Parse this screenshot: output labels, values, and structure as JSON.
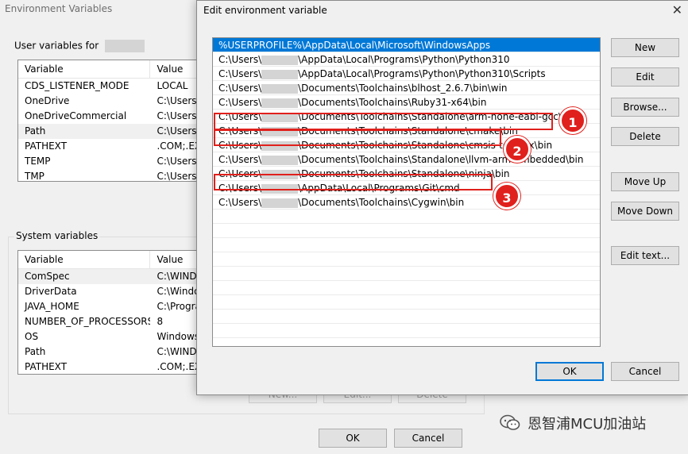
{
  "env_window": {
    "title": "Environment Variables",
    "user_group_label": "User variables for",
    "user_columns": [
      "Variable",
      "Value"
    ],
    "user_rows": [
      {
        "name": "CDS_LISTENER_MODE",
        "value": "LOCAL"
      },
      {
        "name": "OneDrive",
        "value": "C:\\Users\\"
      },
      {
        "name": "OneDriveCommercial",
        "value": "C:\\Users\\"
      },
      {
        "name": "Path",
        "value": "C:\\Users\\"
      },
      {
        "name": "PATHEXT",
        "value": ".COM;.EX"
      },
      {
        "name": "TEMP",
        "value": "C:\\Users\\"
      },
      {
        "name": "TMP",
        "value": "C:\\Users\\"
      }
    ],
    "system_group_label": "System variables",
    "system_columns": [
      "Variable",
      "Value"
    ],
    "system_rows": [
      {
        "name": "ComSpec",
        "value": "C:\\WINDO"
      },
      {
        "name": "DriverData",
        "value": "C:\\Windo"
      },
      {
        "name": "JAVA_HOME",
        "value": "C:\\Progra"
      },
      {
        "name": "NUMBER_OF_PROCESSORS",
        "value": "8"
      },
      {
        "name": "OS",
        "value": "Windows"
      },
      {
        "name": "Path",
        "value": "C:\\WINDO"
      },
      {
        "name": "PATHEXT",
        "value": ".COM;.EX"
      }
    ],
    "system_buttons": {
      "new": "New...",
      "edit": "Edit...",
      "delete": "Delete"
    },
    "ok_label": "OK",
    "cancel_label": "Cancel"
  },
  "edit_dialog": {
    "title": "Edit environment variable",
    "close_glyph": "✕",
    "entries": [
      {
        "pre": "%USERPROFILE%\\AppData\\Local\\Microsoft\\WindowsApps",
        "post": "",
        "selected": true
      },
      {
        "pre": "C:\\Users\\",
        "post": "\\AppData\\Local\\Programs\\Python\\Python310"
      },
      {
        "pre": "C:\\Users\\",
        "post": "\\AppData\\Local\\Programs\\Python\\Python310\\Scripts"
      },
      {
        "pre": "C:\\Users\\",
        "post": "\\Documents\\Toolchains\\blhost_2.6.7\\bin\\win"
      },
      {
        "pre": "C:\\Users\\",
        "post": "\\Documents\\Toolchains\\Ruby31-x64\\bin"
      },
      {
        "pre": "C:\\Users\\",
        "post": "\\Documents\\Toolchains\\Standalone\\arm-none-eabi-gcc\\bin"
      },
      {
        "pre": "C:\\Users\\",
        "post": "\\Documents\\Toolchains\\Standalone\\cmake\\bin"
      },
      {
        "pre": "C:\\Users\\",
        "post": "\\Documents\\Toolchains\\Standalone\\cmsis-toolbox\\bin"
      },
      {
        "pre": "C:\\Users\\",
        "post": "\\Documents\\Toolchains\\Standalone\\llvm-arm-embedded\\bin"
      },
      {
        "pre": "C:\\Users\\",
        "post": "\\Documents\\Toolchains\\Standalone\\ninja\\bin"
      },
      {
        "pre": "C:\\Users\\",
        "post": "\\AppData\\Local\\Programs\\Git\\cmd"
      },
      {
        "pre": "C:\\Users\\",
        "post": "\\Documents\\Toolchains\\Cygwin\\bin"
      }
    ],
    "buttons": {
      "new": "New",
      "edit": "Edit",
      "browse": "Browse...",
      "delete": "Delete",
      "move_up": "Move Up",
      "move_down": "Move Down",
      "edit_text": "Edit text...",
      "ok": "OK",
      "cancel": "Cancel"
    },
    "callouts": [
      "1",
      "2",
      "3"
    ]
  },
  "watermark": {
    "text": "恩智浦MCU加油站",
    "icon": "wechat-icon"
  },
  "colors": {
    "selection": "#0078d7",
    "callout": "#e0201c"
  }
}
